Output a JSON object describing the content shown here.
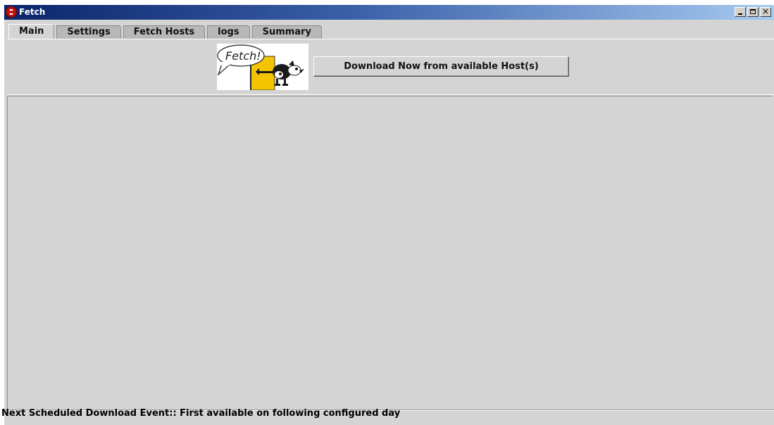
{
  "window": {
    "title": "Fetch",
    "controls": {
      "minimize": "_",
      "maximize": "□",
      "close": "×"
    }
  },
  "tabs": [
    {
      "label": "Main",
      "active": true
    },
    {
      "label": "Settings",
      "active": false
    },
    {
      "label": "Fetch Hosts",
      "active": false
    },
    {
      "label": "logs",
      "active": false
    },
    {
      "label": "Summary",
      "active": false
    }
  ],
  "main": {
    "logo_text": "Fetch!",
    "download_button": "Download Now from available Host(s)"
  },
  "status": {
    "text": "Next Scheduled Download Event:: First available on following configured day"
  },
  "colors": {
    "titlebar_start": "#0a246a",
    "titlebar_end": "#a6caf0",
    "panel_bg": "#d4d4d4",
    "logo_yellow": "#f5c400"
  },
  "icons": {
    "app": "fetch-app-icon",
    "logo": "fetch-dog-logo"
  }
}
